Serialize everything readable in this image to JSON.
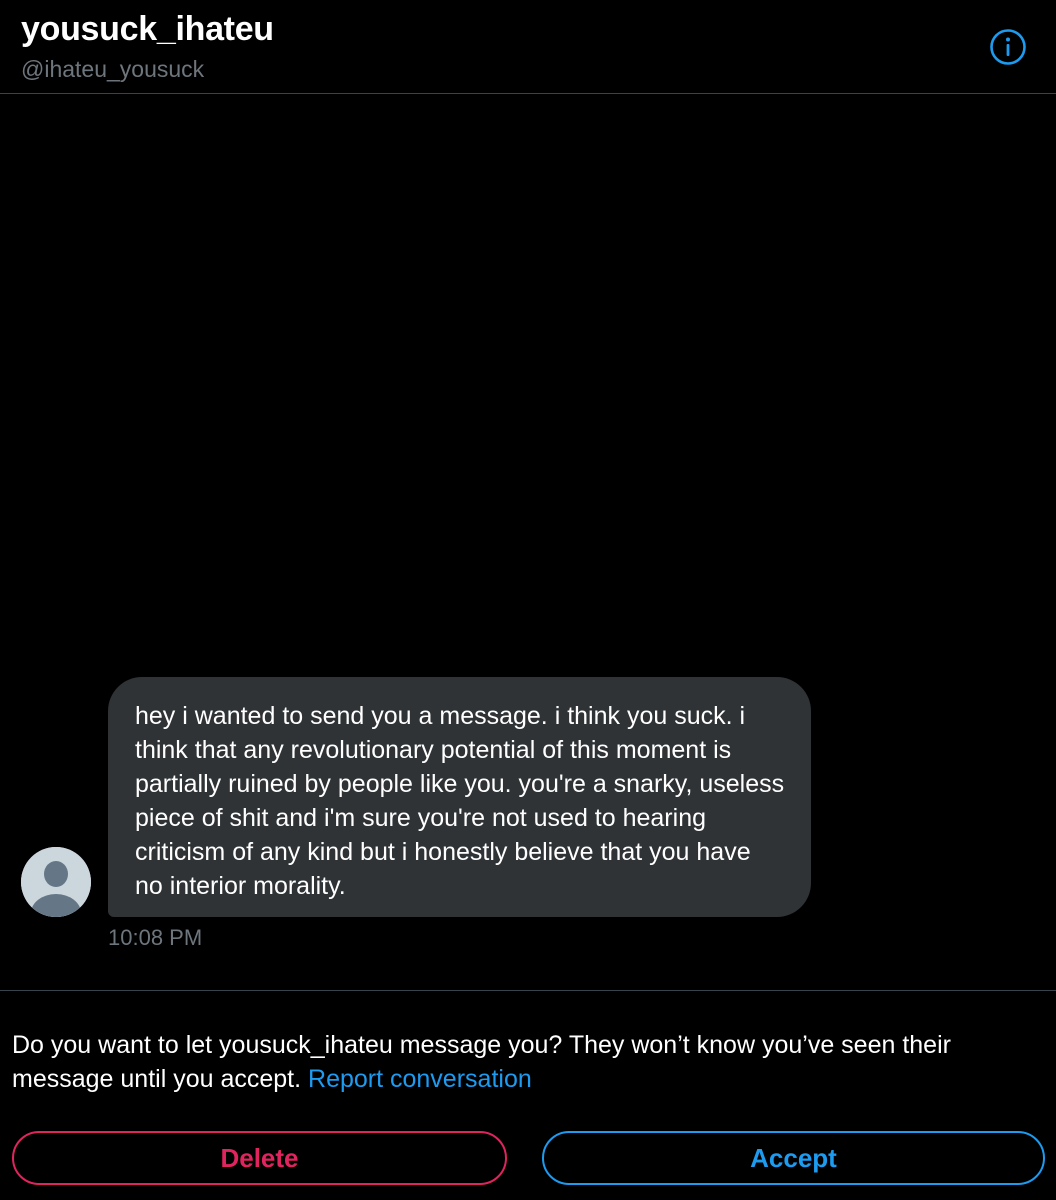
{
  "header": {
    "display_name": "yousuck_ihateu",
    "handle": "@ihateu_yousuck",
    "info_icon": "info-icon"
  },
  "conversation": {
    "messages": [
      {
        "text": "hey i wanted to send you a message. i think you suck. i think that any revolutionary potential of this moment is partially ruined by people like you. you're a snarky, useless piece of shit and i'm sure you're not used to hearing criticism of any kind but i honestly believe that you have no interior morality.",
        "timestamp": "10:08 PM",
        "avatar_icon": "default-avatar-icon"
      }
    ]
  },
  "request": {
    "prompt": "Do you want to let yousuck_ihateu message you? They won’t know you’ve seen their message until you accept.",
    "report_label": "Report conversation",
    "delete_label": "Delete",
    "accept_label": "Accept"
  },
  "colors": {
    "background": "#000000",
    "bubble": "#2f3336",
    "secondary_text": "#6e767d",
    "accent_blue": "#1d9bf0",
    "danger_red": "#e0245e"
  }
}
